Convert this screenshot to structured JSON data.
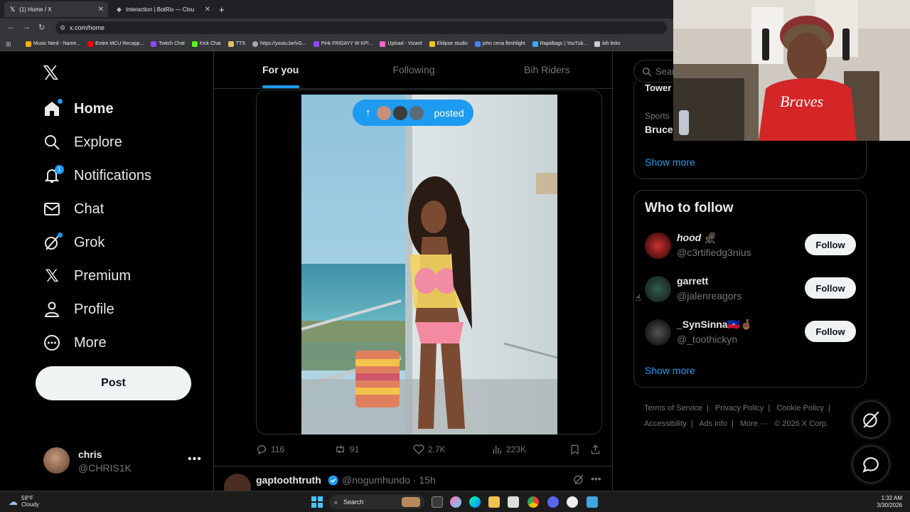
{
  "browser": {
    "tabs": [
      {
        "label": "(1) Home / X",
        "active": true
      },
      {
        "label": "Interaction | BotRix — Clou",
        "active": false
      }
    ],
    "url": "x.com/home",
    "bookmarks": [
      "Music Nerd - Name...",
      "Entire MCU Recapp...",
      "Twitch Chat",
      "Kick Chat",
      "TTS",
      "https://youtu.be/vG...",
      "Pink FRIDAYY W KP!...",
      "Upload - Vizard",
      "Eklipse studio",
      "john cena fleshlight",
      "Rapidtags | YouTub...",
      "bih links"
    ]
  },
  "nav": {
    "items": [
      {
        "label": "Home",
        "icon": "home-icon"
      },
      {
        "label": "Explore",
        "icon": "search-icon"
      },
      {
        "label": "Notifications",
        "icon": "bell-icon",
        "badge": "1"
      },
      {
        "label": "Chat",
        "icon": "mail-icon"
      },
      {
        "label": "Grok",
        "icon": "grok-icon"
      },
      {
        "label": "Premium",
        "icon": "x-logo-icon"
      },
      {
        "label": "Profile",
        "icon": "person-icon"
      },
      {
        "label": "More",
        "icon": "more-circle-icon"
      }
    ],
    "post_label": "Post",
    "account": {
      "name": "chris",
      "handle": "@CHRIS1K"
    }
  },
  "feed": {
    "tabs": [
      "For you",
      "Following",
      "Bih Riders"
    ],
    "active_tab": "For you",
    "posted_pill": "posted",
    "actions": {
      "replies": "116",
      "reposts": "91",
      "likes": "2.7K",
      "views": "223K"
    },
    "next_tweet": {
      "name": "gaptoothtruth",
      "handle": "@nogumhundo · 15h"
    }
  },
  "sidebar": {
    "search_placeholder": "Sear",
    "trend_top": "Tower",
    "trend_category": "Sports",
    "trend_name": "Bruce",
    "show_more": "Show more",
    "who_to_follow": {
      "title": "Who to follow",
      "accounts": [
        {
          "name": "hood 🥷🏿",
          "handle": "@c3rtifiedg3nius",
          "button": "Follow"
        },
        {
          "name": "garrett",
          "handle": "@jalenreagors",
          "button": "Follow"
        },
        {
          "name": "_SynSinna🇭🇹🤞🏾",
          "handle": "@_toothickyn",
          "button": "Follow"
        }
      ],
      "show_more": "Show more"
    },
    "footer": {
      "links": [
        "Terms of Service",
        "Privacy Policy",
        "Cookie Policy",
        "Accessibility",
        "Ads info",
        "More ···"
      ],
      "copyright": "© 2026 X Corp."
    }
  },
  "taskbar": {
    "temp": "59°F",
    "condition": "Cloudy",
    "search": "Search",
    "time": "1:32 AM",
    "date": "3/30/2026"
  },
  "colors": {
    "accent": "#1d9bf0",
    "background": "#000000",
    "muted": "#71767b"
  }
}
